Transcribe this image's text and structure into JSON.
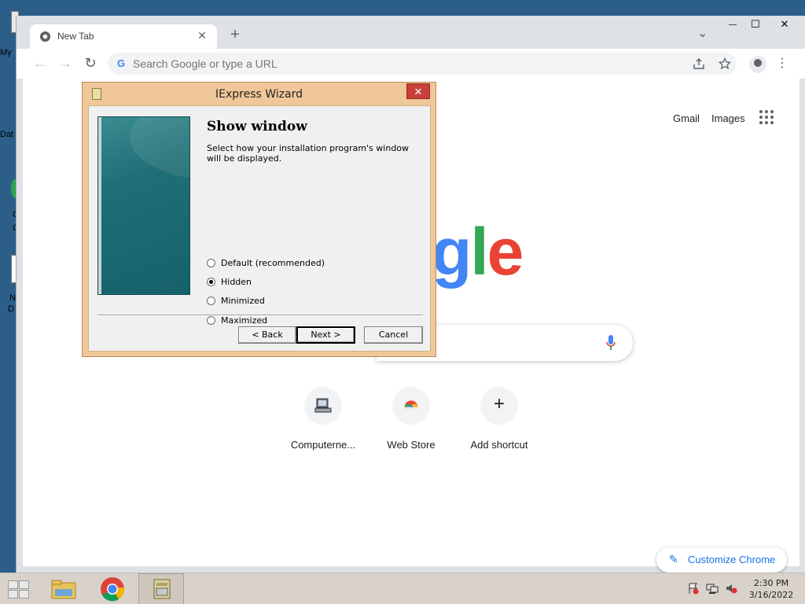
{
  "desktop": {
    "fragments": [
      "My",
      "Dat",
      "C",
      "C",
      "N",
      "D"
    ]
  },
  "browser": {
    "tab": {
      "title": "New Tab",
      "close": "✕"
    },
    "new_tab": "+",
    "window_controls": {
      "dropdown": "⌄",
      "minimize": "—",
      "maximize": "☐",
      "close": "✕"
    },
    "nav": {
      "back": "←",
      "forward": "→",
      "reload": "↻"
    },
    "omnibox": {
      "placeholder": "Search Google or type a URL",
      "g": "G"
    },
    "menu": "⋮"
  },
  "newtab_page": {
    "gmail": "Gmail",
    "images": "Images",
    "logo_fragment": [
      "g",
      "l",
      "e"
    ],
    "logo_colors": [
      "#4285f4",
      "#34a853",
      "#ea4335"
    ],
    "shortcuts": [
      {
        "label": "Computerne...",
        "icon": "computer-icon"
      },
      {
        "label": "Web Store",
        "icon": "chrome-web-store-icon"
      },
      {
        "label": "Add shortcut",
        "icon": "plus-icon",
        "glyph": "+"
      }
    ],
    "customize": {
      "label": "Customize Chrome",
      "icon": "✎"
    }
  },
  "dialog": {
    "title": "IExpress Wizard",
    "close": "✕",
    "heading": "Show window",
    "description": "Select how your installation program's window will be displayed.",
    "options": [
      {
        "label": "Default (recommended)",
        "checked": false
      },
      {
        "label": "Hidden",
        "checked": true
      },
      {
        "label": "Minimized",
        "checked": false
      },
      {
        "label": "Maximized",
        "checked": false
      }
    ],
    "buttons": {
      "back": "< Back",
      "next": "Next >",
      "cancel": "Cancel"
    }
  },
  "taskbar": {
    "clock": {
      "time": "2:30 PM",
      "date": "3/16/2022"
    }
  }
}
